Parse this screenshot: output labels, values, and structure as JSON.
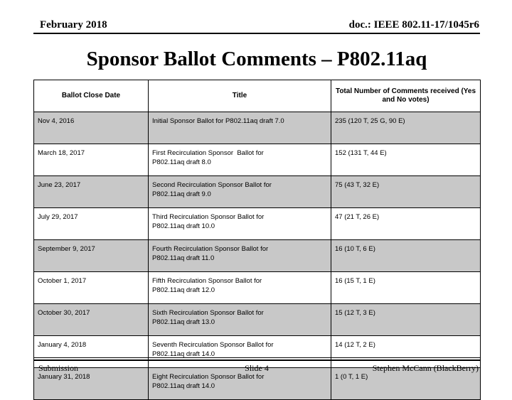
{
  "header": {
    "left": "February 2018",
    "right": "doc.: IEEE 802.11-17/1045r6"
  },
  "title": "Sponsor Ballot Comments – P802.11aq",
  "table": {
    "columns": [
      "Ballot Close Date",
      "Title",
      "Total Number of Comments received (Yes and No votes)"
    ],
    "rows": [
      {
        "date": "Nov 4, 2016",
        "title": "Initial Sponsor Ballot for P802.11aq draft 7.0",
        "comments": "235 (120 T, 25 G, 90 E)",
        "shaded": true
      },
      {
        "date": "March 18, 2017",
        "title": "First Recirculation Sponsor  Ballot for\nP802.11aq draft 8.0",
        "comments": "152 (131 T, 44 E)",
        "shaded": false
      },
      {
        "date": "June 23, 2017",
        "title": "Second Recirculation Sponsor Ballot for\nP802.11aq draft 9.0",
        "comments": "75 (43 T, 32 E)",
        "shaded": true
      },
      {
        "date": "July 29, 2017",
        "title": "Third Recirculation Sponsor Ballot for\nP802.11aq draft 10.0",
        "comments": "47 (21 T, 26 E)",
        "shaded": false
      },
      {
        "date": "September 9, 2017",
        "title": "Fourth Recirculation Sponsor Ballot for\nP802.11aq draft 11.0",
        "comments": "16 (10 T, 6 E)",
        "shaded": true
      },
      {
        "date": "October 1, 2017",
        "title": "Fifth Recirculation Sponsor Ballot for\nP802.11aq draft 12.0",
        "comments": "16 (15 T, 1 E)",
        "shaded": false
      },
      {
        "date": "October 30, 2017",
        "title": "Sixth Recirculation Sponsor Ballot for\nP802.11aq draft 13.0",
        "comments": "15 (12 T, 3 E)",
        "shaded": true
      },
      {
        "date": "January 4, 2018",
        "title": "Seventh Recirculation Sponsor Ballot for\nP802.11aq draft 14.0",
        "comments": "14 (12 T, 2 E)",
        "shaded": false
      },
      {
        "date": "January 31, 2018",
        "title": "Eight Recirculation Sponsor Ballot for\nP802.11aq draft 14.0",
        "comments": "1 (0 T, 1 E)",
        "shaded": true
      }
    ]
  },
  "footer": {
    "left": "Submission",
    "center": "Slide 4",
    "right": "Stephen McCann (BlackBerry)"
  },
  "colors": {
    "page_background": "#ffffff",
    "row_shaded": "#c8c8c8",
    "text": "#000000",
    "border": "#000000"
  }
}
